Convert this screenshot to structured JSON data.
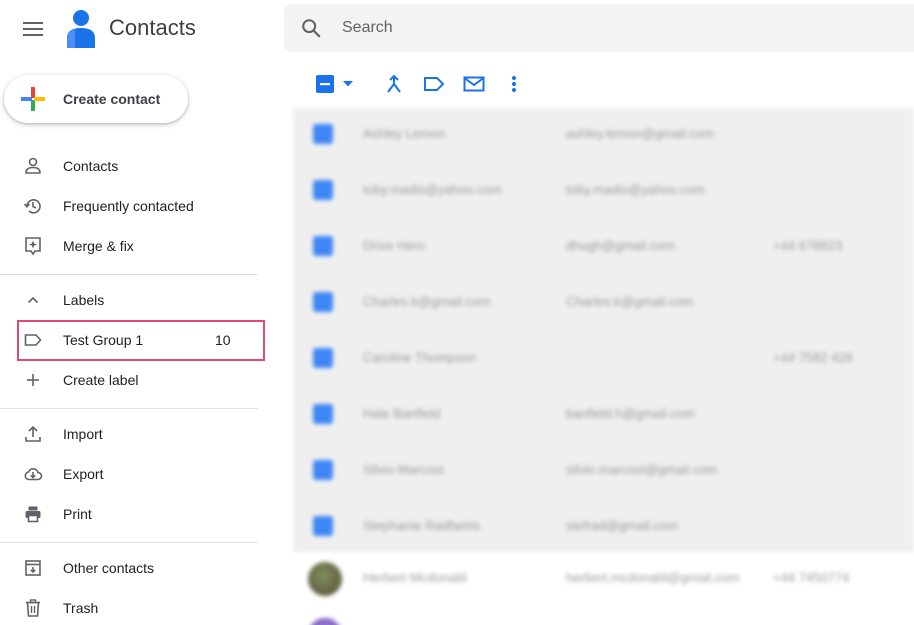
{
  "header": {
    "app_title": "Contacts",
    "search_placeholder": "Search"
  },
  "create_button": {
    "label": "Create contact"
  },
  "sidebar": {
    "items": [
      {
        "label": "Contacts",
        "icon": "person-icon"
      },
      {
        "label": "Frequently contacted",
        "icon": "history-icon"
      },
      {
        "label": "Merge & fix",
        "icon": "merge-fix-icon"
      }
    ],
    "labels_section": {
      "label": "Labels",
      "icon": "chevron-up-icon"
    },
    "label_items": [
      {
        "label": "Test Group 1",
        "count": "10",
        "icon": "label-icon"
      }
    ],
    "create_label": {
      "label": "Create label",
      "icon": "plus-icon"
    },
    "tools": [
      {
        "label": "Import",
        "icon": "upload-icon"
      },
      {
        "label": "Export",
        "icon": "cloud-download-icon"
      },
      {
        "label": "Print",
        "icon": "printer-icon"
      }
    ],
    "other": [
      {
        "label": "Other contacts",
        "icon": "archive-icon"
      },
      {
        "label": "Trash",
        "icon": "trash-icon"
      }
    ]
  },
  "toolbar": {
    "icons": [
      "select-checkbox-icon",
      "dropdown-caret-icon",
      "merge-icon",
      "label-icon",
      "email-icon",
      "more-vert-icon"
    ]
  },
  "contacts": [
    {
      "name": "Ashley Lemon",
      "email": "ashley.lemon@gmail.com",
      "phone": ""
    },
    {
      "name": "toby.madis@yahoo.com",
      "email": "toby.madis@yahoo.com",
      "phone": ""
    },
    {
      "name": "Drive Hero",
      "email": "dhugh@gmail.com",
      "phone": "+44 678823"
    },
    {
      "name": "Charles.k@gmail.com",
      "email": "Charles.k@gmail.com",
      "phone": ""
    },
    {
      "name": "Caroline Thompson",
      "email": "",
      "phone": "+44 7582 426"
    },
    {
      "name": "Hale Banfield",
      "email": "banfield.h@gmail.com",
      "phone": ""
    },
    {
      "name": "Silvio Marcost",
      "email": "silvio.marcost@gmail.com",
      "phone": ""
    },
    {
      "name": "Stephanie Radfamis",
      "email": "stefrad@gmail.com",
      "phone": ""
    },
    {
      "name": "Herbert Mcdonald",
      "email": "herbert.mcdonald@gmail.com",
      "phone": "+44 7450774"
    }
  ],
  "colors": {
    "accent": "#1a73e8",
    "highlight_border": "#e2487a",
    "checkbox_blue": "#3f86f5"
  }
}
